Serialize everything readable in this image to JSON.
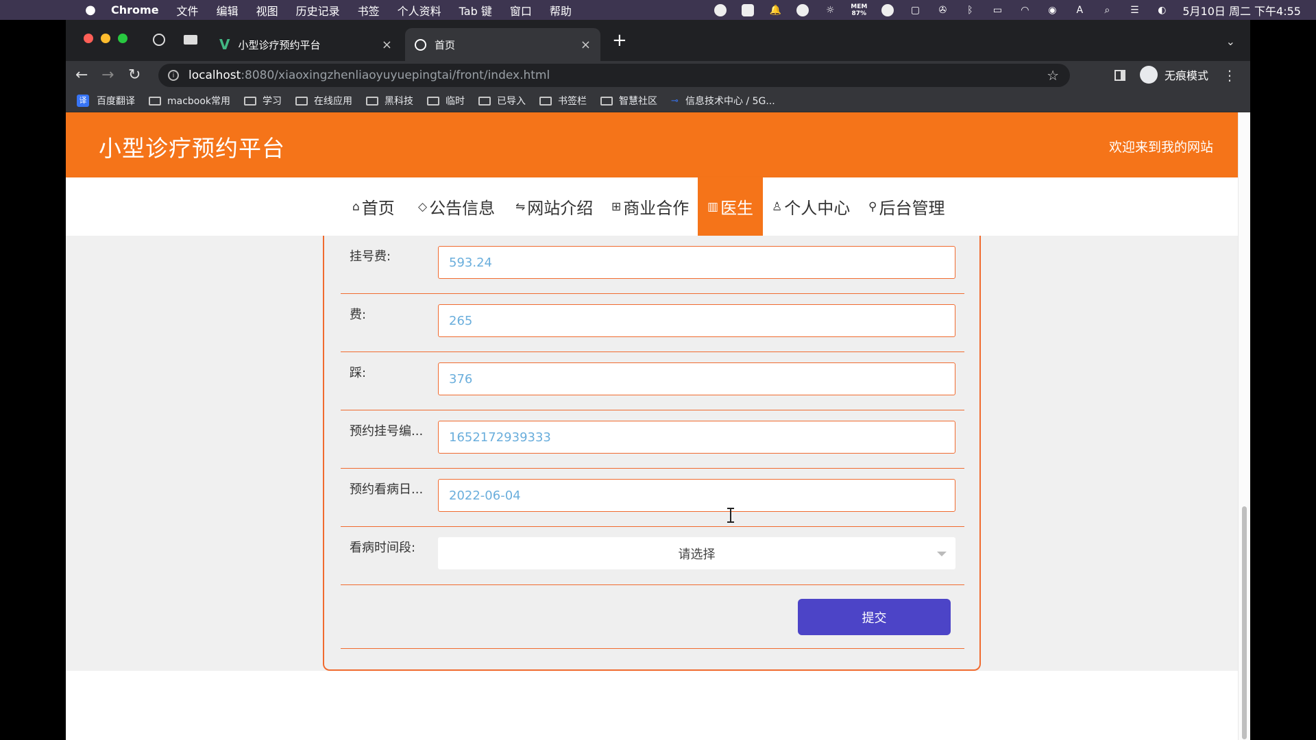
{
  "os_menubar": {
    "app": "Chrome",
    "menus": [
      "文件",
      "编辑",
      "视图",
      "历史记录",
      "书签",
      "个人资料",
      "Tab 键",
      "窗口",
      "帮助"
    ],
    "mem": "MEM\n87%",
    "input_method": "A",
    "clock": "5月10日 周二 下午4:55"
  },
  "browser": {
    "tabs": [
      {
        "title": "小型诊疗预约平台",
        "close": "×"
      },
      {
        "title": "首页",
        "close": "×"
      }
    ],
    "new_tab": "+",
    "url_host": "localhost",
    "url_path": ":8080/xiaoxingzhenliaoyuyuepingtai/front/index.html",
    "profile_label": "无痕模式",
    "bookmarks": [
      {
        "label": "百度翻译",
        "icon": "translate-icon"
      },
      {
        "label": "macbook常用",
        "icon": "folder-icon"
      },
      {
        "label": "学习",
        "icon": "folder-icon"
      },
      {
        "label": "在线应用",
        "icon": "folder-icon"
      },
      {
        "label": "黑科技",
        "icon": "folder-icon"
      },
      {
        "label": "临时",
        "icon": "folder-icon"
      },
      {
        "label": "已导入",
        "icon": "folder-icon"
      },
      {
        "label": "书签栏",
        "icon": "folder-icon"
      },
      {
        "label": "智慧社区",
        "icon": "folder-icon"
      },
      {
        "label": "信息技术中心 / 5G...",
        "icon": "link-icon"
      }
    ]
  },
  "site": {
    "title": "小型诊疗预约平台",
    "welcome": "欢迎来到我的网站",
    "nav": [
      {
        "label": "首页",
        "icon": "⌂"
      },
      {
        "label": "公告信息",
        "icon": "◇"
      },
      {
        "label": "网站介绍",
        "icon": "⇋"
      },
      {
        "label": "商业合作",
        "icon": "⊞"
      },
      {
        "label": "医生",
        "icon": "▥",
        "active": true
      },
      {
        "label": "个人中心",
        "icon": "♙"
      },
      {
        "label": "后台管理",
        "icon": "⚲"
      }
    ]
  },
  "form": {
    "fields": [
      {
        "label": "挂号费:",
        "value": "593.24"
      },
      {
        "label": "费:",
        "value": "265"
      },
      {
        "label": "踩:",
        "value": "376"
      },
      {
        "label": "预约挂号编...",
        "value": "1652172939333"
      },
      {
        "label": "预约看病日...",
        "value": "2022-06-04"
      }
    ],
    "time_slot": {
      "label": "看病时间段:",
      "placeholder": "请选择"
    },
    "submit": "提交"
  },
  "colors": {
    "brand_orange": "#f57419",
    "submit_blue": "#4c44c7",
    "input_text": "#6aaedc"
  }
}
